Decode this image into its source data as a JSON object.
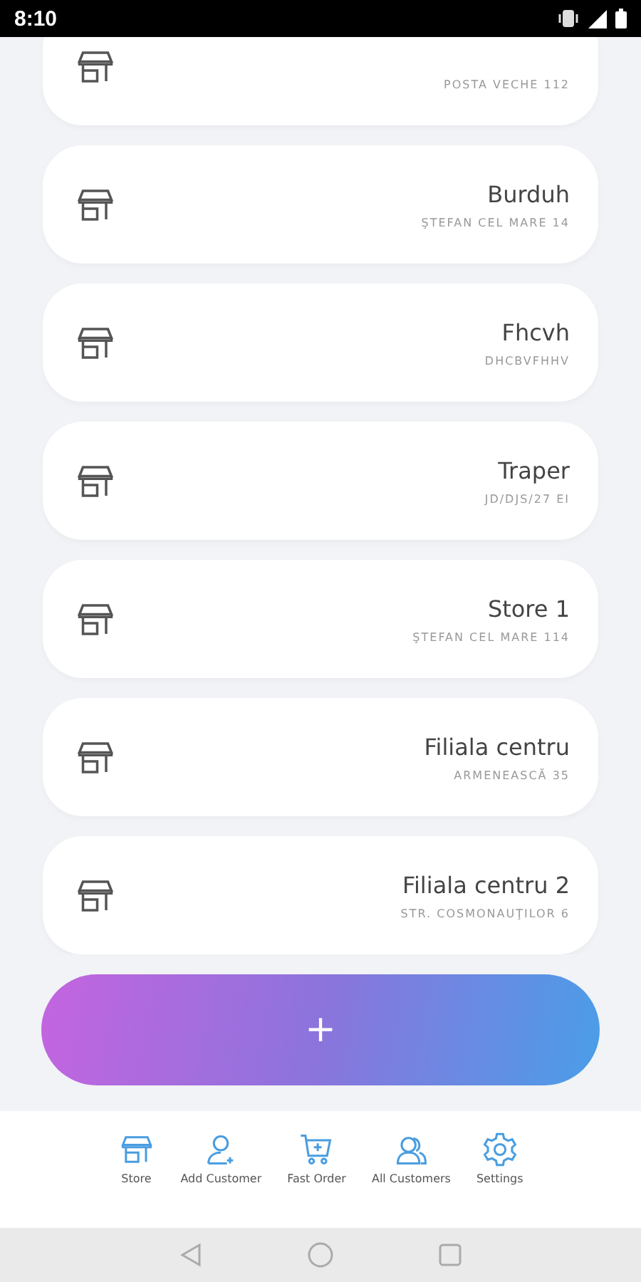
{
  "status_bar": {
    "time": "8:10"
  },
  "stores": [
    {
      "address": "POSTA VECHE 112"
    },
    {
      "name": "Burduh",
      "address": "ŞTEFAN CEL MARE 14"
    },
    {
      "name": "Fhcvh",
      "address": "DHCBVFHHV"
    },
    {
      "name": "Traper",
      "address": "JD/DJS/27 EI"
    },
    {
      "name": "Store 1",
      "address": "ŞTEFAN CEL MARE 114"
    },
    {
      "name": "Filiala centru",
      "address": "ARMENEASCĂ 35"
    },
    {
      "name": "Filiala centru 2",
      "address": "STR. COSMONAUŢILOR 6"
    }
  ],
  "add_button": {
    "label": "+"
  },
  "bottom_nav": [
    {
      "label": "Store",
      "kind": "store"
    },
    {
      "label": "Add Customer",
      "kind": "add-customer"
    },
    {
      "label": "Fast Order",
      "kind": "cart"
    },
    {
      "label": "All Customers",
      "kind": "customers"
    },
    {
      "label": "Settings",
      "kind": "settings"
    }
  ]
}
